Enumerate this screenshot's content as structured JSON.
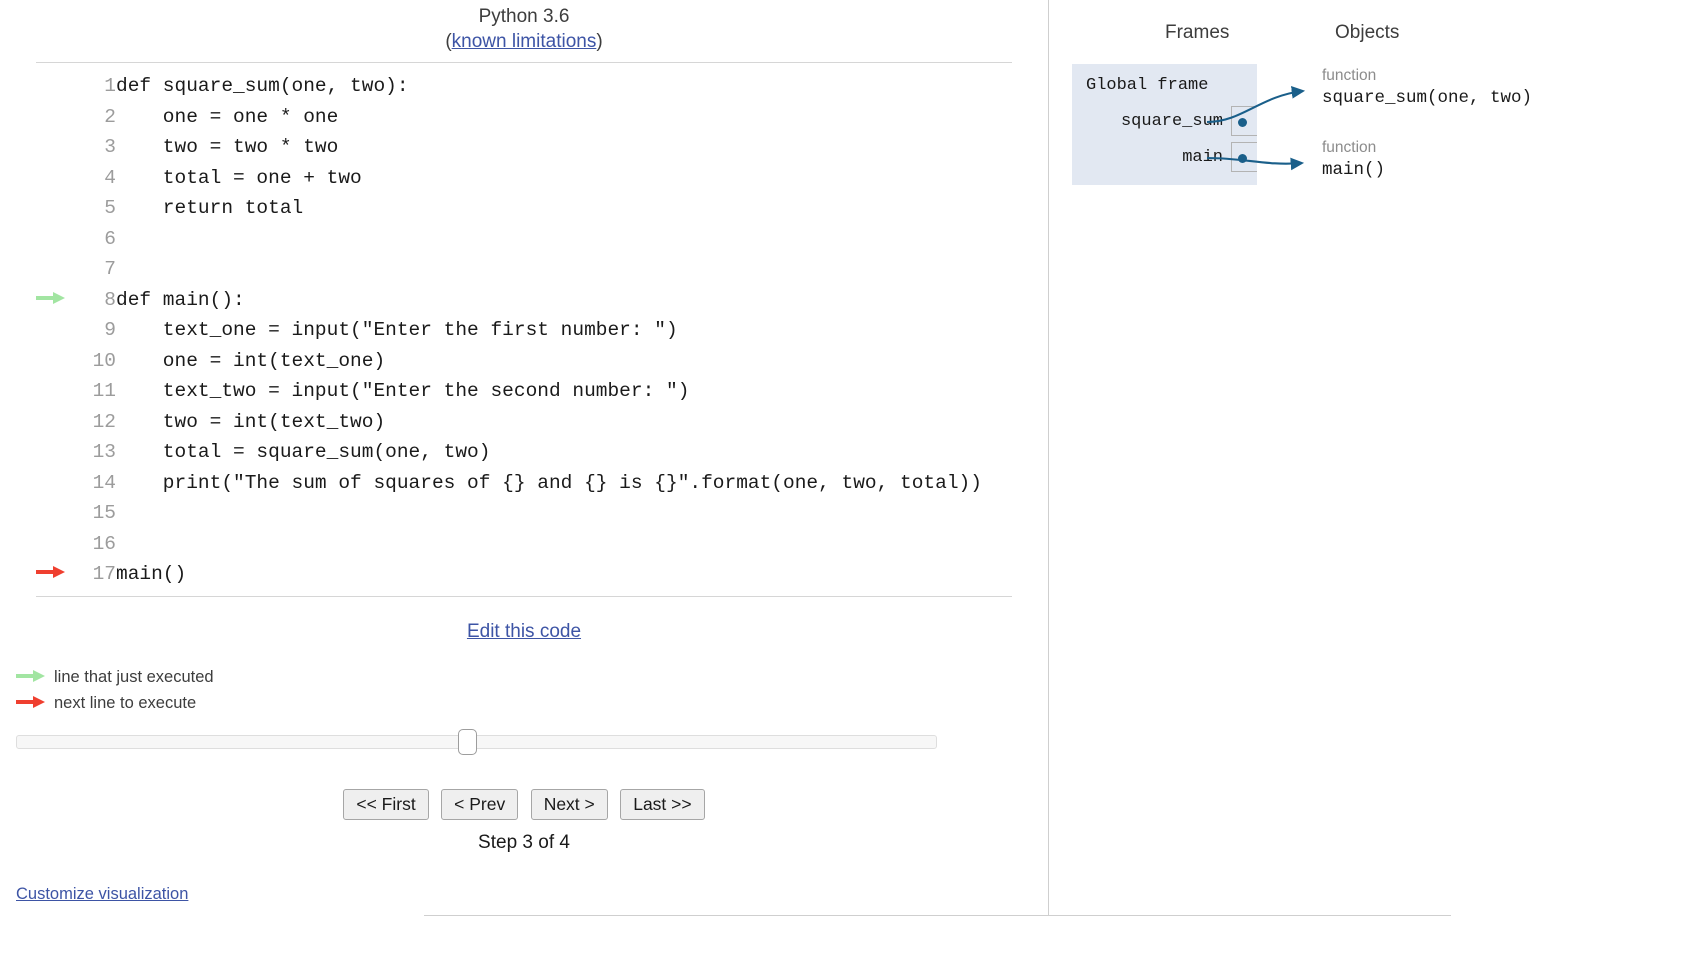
{
  "header": {
    "version": "Python 3.6",
    "limitations_prefix": "(",
    "limitations_link": "known limitations",
    "limitations_suffix": ")"
  },
  "code": {
    "lines": [
      {
        "n": "1",
        "text": "def square_sum(one, two):",
        "marker": "none"
      },
      {
        "n": "2",
        "text": "    one = one * one",
        "marker": "none"
      },
      {
        "n": "3",
        "text": "    two = two * two",
        "marker": "none"
      },
      {
        "n": "4",
        "text": "    total = one + two",
        "marker": "none"
      },
      {
        "n": "5",
        "text": "    return total",
        "marker": "none"
      },
      {
        "n": "6",
        "text": "",
        "marker": "none"
      },
      {
        "n": "7",
        "text": "",
        "marker": "none"
      },
      {
        "n": "8",
        "text": "def main():",
        "marker": "green"
      },
      {
        "n": "9",
        "text": "    text_one = input(\"Enter the first number: \")",
        "marker": "none"
      },
      {
        "n": "10",
        "text": "    one = int(text_one)",
        "marker": "none"
      },
      {
        "n": "11",
        "text": "    text_two = input(\"Enter the second number: \")",
        "marker": "none"
      },
      {
        "n": "12",
        "text": "    two = int(text_two)",
        "marker": "none"
      },
      {
        "n": "13",
        "text": "    total = square_sum(one, two)",
        "marker": "none"
      },
      {
        "n": "14",
        "text": "    print(\"The sum of squares of {} and {} is {}\".format(one, two, total))",
        "marker": "none"
      },
      {
        "n": "15",
        "text": "",
        "marker": "none"
      },
      {
        "n": "16",
        "text": "",
        "marker": "none"
      },
      {
        "n": "17",
        "text": "main()",
        "marker": "red"
      }
    ]
  },
  "edit_code_link": "Edit this code",
  "legend": {
    "just_executed": "line that just executed",
    "next_to_execute": "next line to execute"
  },
  "controls": {
    "first": "<< First",
    "prev": "< Prev",
    "next": "Next >",
    "last": "Last >>",
    "step_label": "Step 3 of 4",
    "slider_position_percent": 49
  },
  "customize_link": "Customize visualization",
  "visualization": {
    "frames_title": "Frames",
    "objects_title": "Objects",
    "global_frame": {
      "title": "Global frame",
      "variables": [
        {
          "name": "square_sum"
        },
        {
          "name": "main"
        }
      ]
    },
    "objects": [
      {
        "type": "function",
        "label": "square_sum(one, two)"
      },
      {
        "type": "function",
        "label": "main()"
      }
    ]
  },
  "colors": {
    "green_arrow": "#a2e5a2",
    "red_arrow": "#ef3f2f",
    "frame_bg": "#e2e8f2",
    "pointer": "#1a5f8a",
    "link": "#3d54a5"
  }
}
